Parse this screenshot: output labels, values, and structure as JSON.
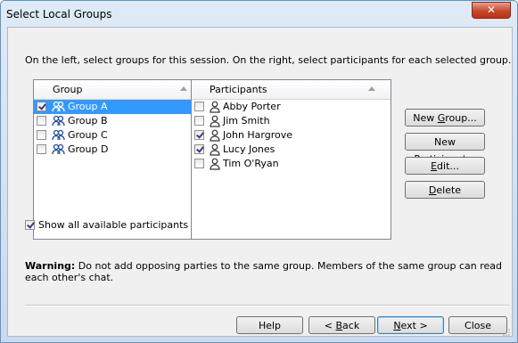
{
  "window": {
    "title": "Select Local Groups",
    "close_glyph": "✕"
  },
  "instructions": "On the left, select groups for this session. On the right, select participants for each selected group.",
  "groups_list": {
    "header": "Group",
    "items": [
      {
        "label": "Group A",
        "checked": true,
        "selected": true,
        "icon": "group-icon"
      },
      {
        "label": "Group B",
        "checked": false,
        "selected": false,
        "icon": "group-icon"
      },
      {
        "label": "Group C",
        "checked": false,
        "selected": false,
        "icon": "group-icon"
      },
      {
        "label": "Group D",
        "checked": false,
        "selected": false,
        "icon": "group-icon"
      }
    ]
  },
  "participants_list": {
    "header": "Participants",
    "items": [
      {
        "label": "Abby Porter",
        "checked": false,
        "icon": "person-icon"
      },
      {
        "label": "Jim Smith",
        "checked": false,
        "icon": "person-icon"
      },
      {
        "label": "John Hargrove",
        "checked": true,
        "icon": "person-icon"
      },
      {
        "label": "Lucy Jones",
        "checked": true,
        "icon": "person-icon"
      },
      {
        "label": "Tim O'Ryan",
        "checked": false,
        "icon": "person-icon"
      }
    ]
  },
  "side_buttons": {
    "new_group": {
      "pre": "New ",
      "key": "G",
      "post": "roup..."
    },
    "new_participant": {
      "pre": "New ",
      "key": "P",
      "post": "articipant..."
    },
    "edit": {
      "pre": "",
      "key": "E",
      "post": "dit..."
    },
    "delete": {
      "pre": "",
      "key": "D",
      "post": "elete"
    }
  },
  "show_all": {
    "label": "Show all available participants",
    "checked": true
  },
  "warning": {
    "bold": "Warning:",
    "text": " Do not add opposing parties to the same group. Members of the same group can read each other's chat."
  },
  "footer_buttons": {
    "help": "Help",
    "back": {
      "pre": "< ",
      "key": "B",
      "post": "ack"
    },
    "next": {
      "pre": "",
      "key": "N",
      "post": "ext >"
    },
    "close": "Close"
  },
  "colors": {
    "selection": "#3399ff",
    "window_frame": "#c9daee",
    "client_bg": "#f0f0f0",
    "close_button": "#c7462a"
  }
}
